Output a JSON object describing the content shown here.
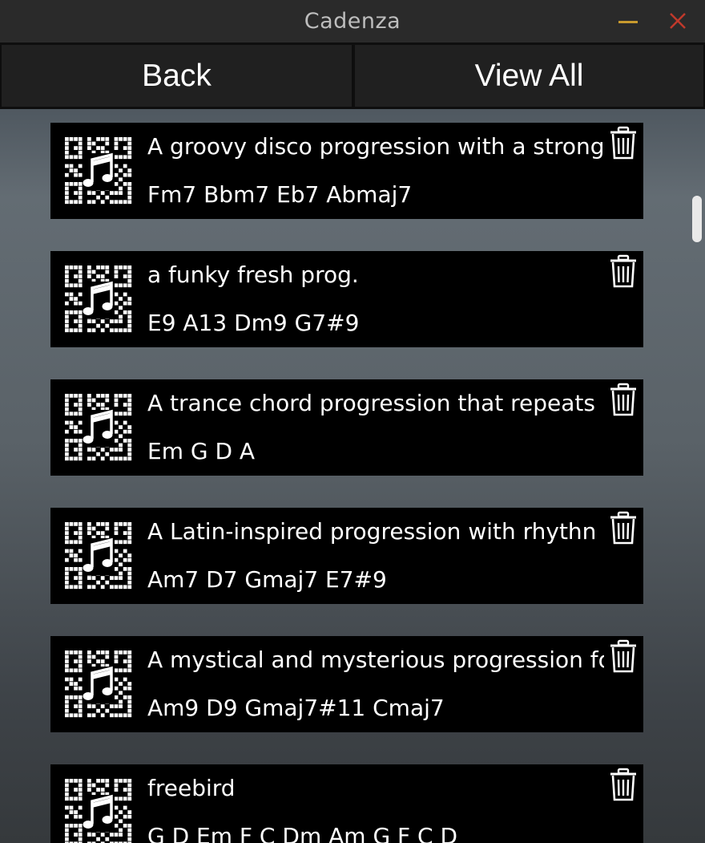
{
  "window": {
    "title": "Cadenza",
    "minimize_icon": "minimize-icon",
    "close_icon": "close-icon",
    "minimize_color": "#c79a2e",
    "close_color": "#c0392b"
  },
  "nav": {
    "back_label": "Back",
    "view_all_label": "View All"
  },
  "progressions": [
    {
      "description": "A groovy disco progression with a strong",
      "chords": "Fm7 Bbm7 Eb7 Abmaj7"
    },
    {
      "description": "a funky fresh prog.",
      "chords": "E9 A13 Dm9 G7#9"
    },
    {
      "description": "A trance chord progression that repeats",
      "chords": "Em G D A"
    },
    {
      "description": "A Latin-inspired progression with rhythn",
      "chords": "Am7 D7 Gmaj7 E7#9"
    },
    {
      "description": "A mystical and mysterious progression fo",
      "chords": "Am9 D9 Gmaj7#11 Cmaj7"
    },
    {
      "description": "freebird",
      "chords": "G D Em F C Dm Am G F C D"
    }
  ],
  "icons": {
    "card_thumbnail": "music-note-qr-icon",
    "delete": "trash-icon"
  }
}
